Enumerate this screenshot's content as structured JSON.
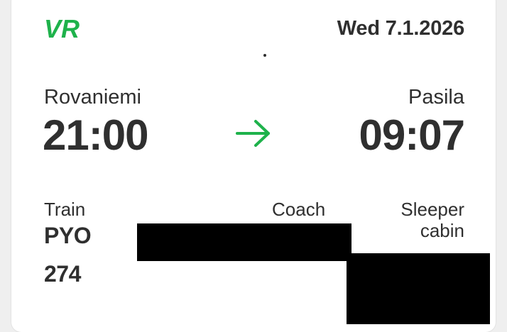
{
  "ticket": {
    "brand": "VR",
    "date": "Wed 7.1.2026",
    "origin": "Rovaniemi",
    "destination": "Pasila",
    "departure_time": "21:00",
    "arrival_time": "09:07",
    "train_label": "Train",
    "train_type": "PYO",
    "train_number": "274",
    "coach_label": "Coach",
    "sleeper_label": "Sleeper",
    "sleeper_sub": "cabin"
  },
  "colors": {
    "brand_green": "#1eb24b",
    "text": "#2f2f2f",
    "redaction": "#000000"
  },
  "icons": {
    "logo": "vr-logo-icon",
    "arrow": "arrow-right-icon"
  }
}
